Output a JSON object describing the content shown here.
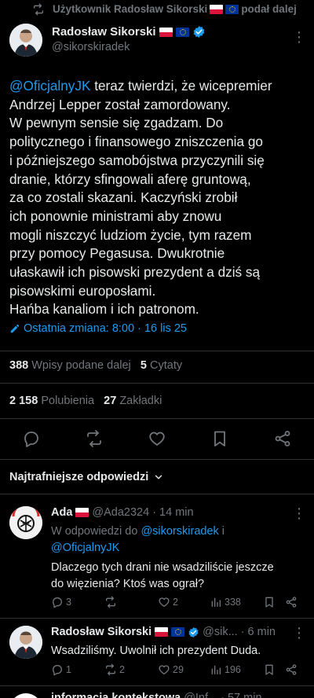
{
  "retweet_banner": {
    "text": "Użytkownik Radosław Sikorski",
    "suffix": "podał dalej"
  },
  "main_tweet": {
    "author_name": "Radosław Sikorski",
    "author_handle": "@sikorskiradek",
    "mention": "@OficjalnyJK",
    "lines": [
      " teraz twierdzi, że wicepremier",
      "Andrzej Lepper został zamordowany.",
      "W pewnym sensie się zgadzam. Do",
      "politycznego i finansowego zniszczenia go",
      "i późniejszego samobójstwa przyczynili się",
      "dranie, którzy sfingowali aferę gruntową,",
      "za co zostali skazani. Kaczyński zrobił",
      "ich ponownie ministrami aby znowu",
      "mogli niszczyć ludziom życie, tym razem",
      "przy pomocy Pegasusa.  Dwukrotnie",
      "ułaskawił ich pisowski prezydent a dziś są",
      "pisowskimi europosłami.",
      "Hańba kanaliom i ich patronom."
    ],
    "edited_label": "Ostatnia zmiana: 8:00 · 16 lis 25",
    "reposts_count": "388",
    "reposts_label": "Wpisy podane dalej",
    "quotes_count": "5",
    "quotes_label": "Cytaty",
    "likes_count": "2 158",
    "likes_label": "Polubienia",
    "bookmarks_count": "27",
    "bookmarks_label": "Zakładki"
  },
  "replies_sort": {
    "label": "Najtrafniejsze odpowiedzi"
  },
  "replies": [
    {
      "author_name": "Ada",
      "author_handle": "@Ada2324",
      "time": "· 14 min",
      "reply_to_prefix": "W odpowiedzi do",
      "reply_to_1": "@sikorskiradek",
      "reply_to_and": " i",
      "reply_to_2": "@OficjalnyJK",
      "text_lines": [
        "Dlaczego tych drani nie wsadziliście jeszcze",
        "do więzienia? Ktoś was ograł?"
      ],
      "replies": "3",
      "reposts": "",
      "likes": "2",
      "views": "338"
    },
    {
      "author_name": "Radosław Sikorski",
      "author_handle": "@sik...",
      "time": "· 6 min",
      "text_lines": [
        "Wsadziliśmy. Uwolnił ich prezydent Duda."
      ],
      "replies": "1",
      "reposts": "2",
      "likes": "29",
      "views": "196"
    },
    {
      "author_name": "informacja kontekstowa",
      "author_handle": "@Inf...",
      "time": "· 57 min"
    }
  ],
  "colors": {
    "accent": "#1d9bf0",
    "muted": "#71767b",
    "text": "#e7e9ea",
    "background": "#000000",
    "divider": "#2f3336"
  }
}
